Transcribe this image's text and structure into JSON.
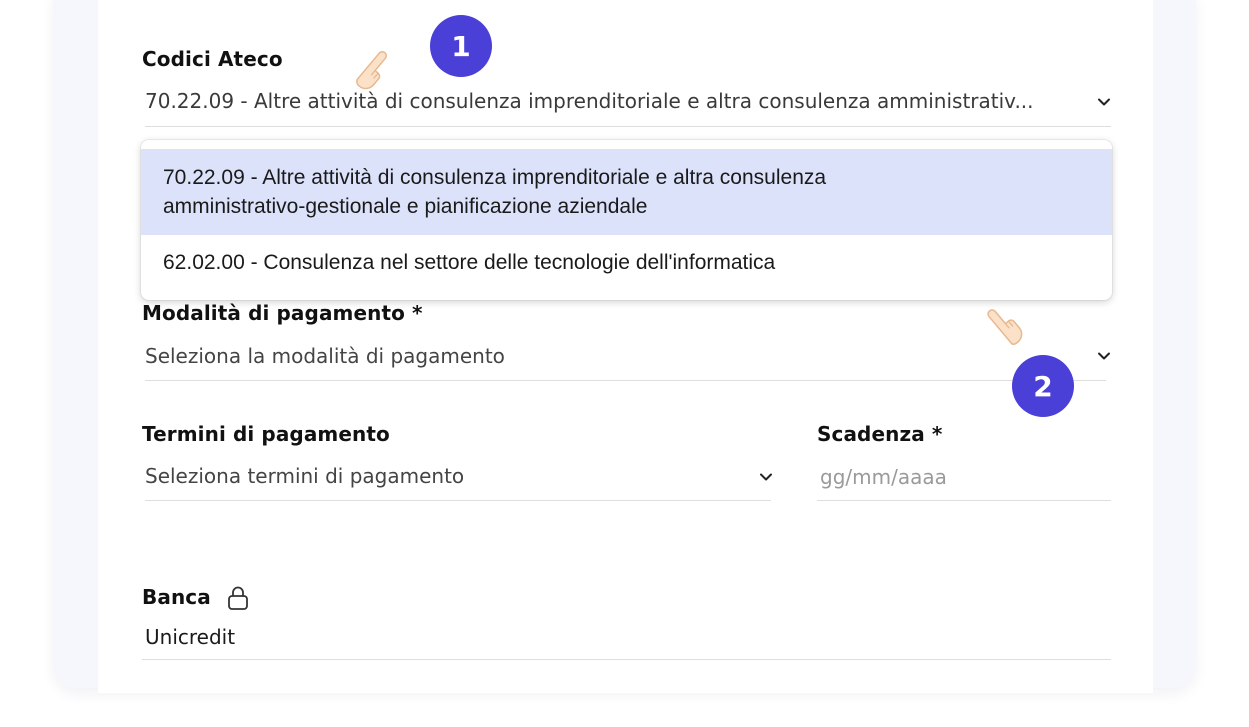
{
  "ateco": {
    "label": "Codici Ateco",
    "selected_value": "70.22.09 - Altre attività di consulenza imprenditoriale e altra consulenza amministrativ...",
    "options": [
      {
        "line1": "70.22.09 - Altre attività di consulenza imprenditoriale e altra consulenza",
        "line2": "amministrativo-gestionale e pianificazione aziendale",
        "highlighted": true
      },
      {
        "line1": "62.02.00 - Consulenza nel settore delle tecnologie dell'informatica",
        "highlighted": false
      }
    ]
  },
  "payment_method": {
    "label": "Modalità di pagamento *",
    "placeholder": "Seleziona la modalità di pagamento"
  },
  "payment_terms": {
    "label": "Termini di pagamento",
    "placeholder": "Seleziona termini di pagamento"
  },
  "due_date": {
    "label": "Scadenza *",
    "placeholder": "gg/mm/aaaa"
  },
  "bank": {
    "label": "Banca",
    "value": "Unicredit",
    "icon": "lock-icon"
  },
  "annotations": {
    "step1": "1",
    "step2": "2",
    "badge_color": "#4a3fd6",
    "hand_icon": "pointing-hand-icon"
  },
  "colors": {
    "highlight": "#dde2fb",
    "card_background": "#f6f6fd"
  }
}
